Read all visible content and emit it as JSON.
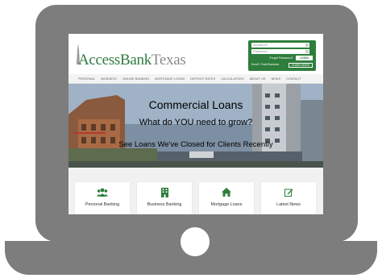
{
  "site": {
    "logo_main": "AccessBank",
    "logo_accent": "Texas",
    "brand_green": "#2e7d3c"
  },
  "login": {
    "user_placeholder": "Access ID",
    "password_placeholder": "Password",
    "forgot_label": "Forgot Password?",
    "login_label": "LOGIN",
    "promo_label": "Enroll • Treat Business",
    "learn_label": "LEARN MORE"
  },
  "nav": {
    "items": [
      "PERSONAL",
      "BUSINESS",
      "ONLINE BANKING",
      "MORTGAGE LOANS",
      "DEPOSIT RATES",
      "CALCULATORS",
      "ABOUT US",
      "NEWS",
      "CONTACT"
    ]
  },
  "hero": {
    "line1": "Commercial Loans",
    "line2": "What do YOU need to grow?",
    "line3": "See Loans We've Closed for Clients Recently"
  },
  "cards": [
    {
      "label": "Personal Banking",
      "icon": "users-icon"
    },
    {
      "label": "Business Banking",
      "icon": "building-icon"
    },
    {
      "label": "Mortgage Loans",
      "icon": "home-icon"
    },
    {
      "label": "Latest News",
      "icon": "edit-icon"
    }
  ]
}
